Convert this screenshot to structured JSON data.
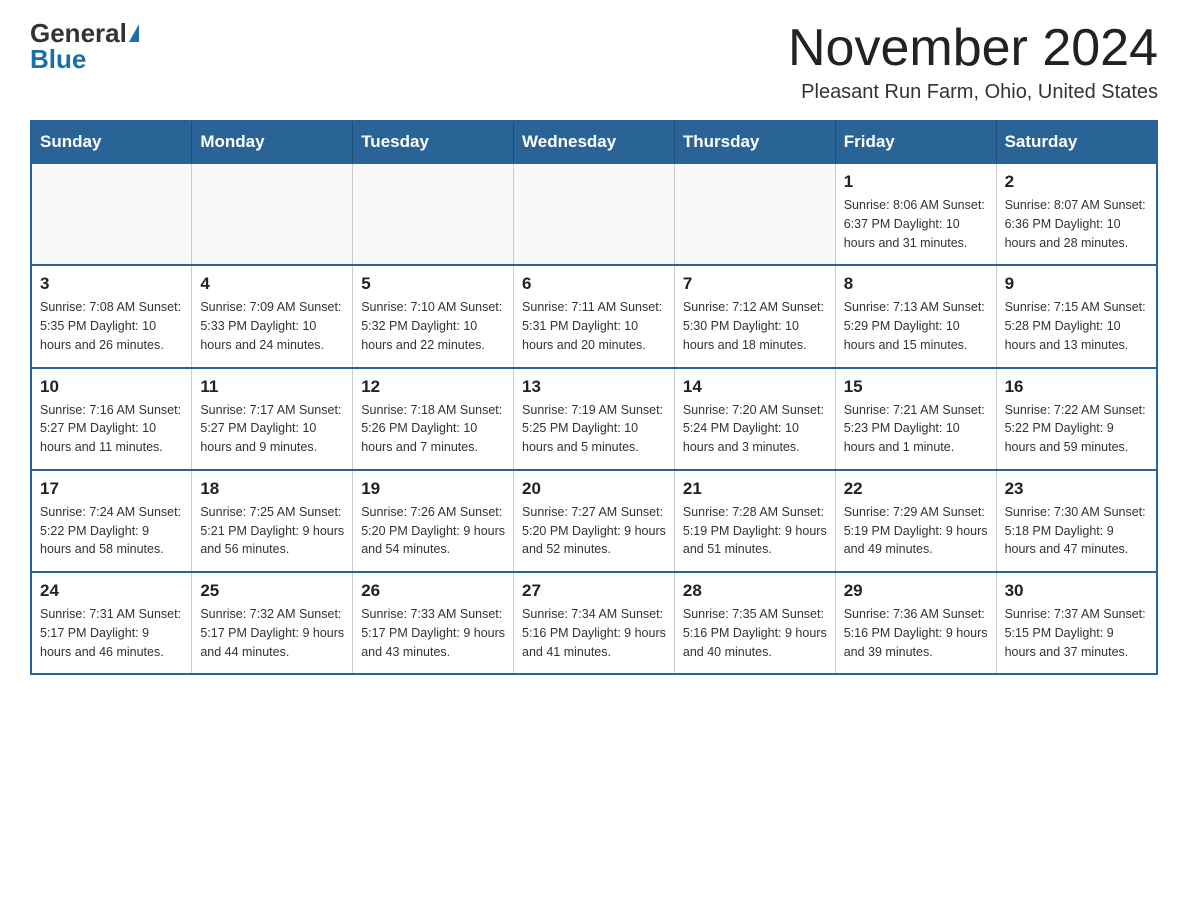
{
  "header": {
    "logo_general": "General",
    "logo_blue": "Blue",
    "month_title": "November 2024",
    "subtitle": "Pleasant Run Farm, Ohio, United States"
  },
  "weekdays": [
    "Sunday",
    "Monday",
    "Tuesday",
    "Wednesday",
    "Thursday",
    "Friday",
    "Saturday"
  ],
  "rows": [
    [
      {
        "day": "",
        "info": ""
      },
      {
        "day": "",
        "info": ""
      },
      {
        "day": "",
        "info": ""
      },
      {
        "day": "",
        "info": ""
      },
      {
        "day": "",
        "info": ""
      },
      {
        "day": "1",
        "info": "Sunrise: 8:06 AM\nSunset: 6:37 PM\nDaylight: 10 hours\nand 31 minutes."
      },
      {
        "day": "2",
        "info": "Sunrise: 8:07 AM\nSunset: 6:36 PM\nDaylight: 10 hours\nand 28 minutes."
      }
    ],
    [
      {
        "day": "3",
        "info": "Sunrise: 7:08 AM\nSunset: 5:35 PM\nDaylight: 10 hours\nand 26 minutes."
      },
      {
        "day": "4",
        "info": "Sunrise: 7:09 AM\nSunset: 5:33 PM\nDaylight: 10 hours\nand 24 minutes."
      },
      {
        "day": "5",
        "info": "Sunrise: 7:10 AM\nSunset: 5:32 PM\nDaylight: 10 hours\nand 22 minutes."
      },
      {
        "day": "6",
        "info": "Sunrise: 7:11 AM\nSunset: 5:31 PM\nDaylight: 10 hours\nand 20 minutes."
      },
      {
        "day": "7",
        "info": "Sunrise: 7:12 AM\nSunset: 5:30 PM\nDaylight: 10 hours\nand 18 minutes."
      },
      {
        "day": "8",
        "info": "Sunrise: 7:13 AM\nSunset: 5:29 PM\nDaylight: 10 hours\nand 15 minutes."
      },
      {
        "day": "9",
        "info": "Sunrise: 7:15 AM\nSunset: 5:28 PM\nDaylight: 10 hours\nand 13 minutes."
      }
    ],
    [
      {
        "day": "10",
        "info": "Sunrise: 7:16 AM\nSunset: 5:27 PM\nDaylight: 10 hours\nand 11 minutes."
      },
      {
        "day": "11",
        "info": "Sunrise: 7:17 AM\nSunset: 5:27 PM\nDaylight: 10 hours\nand 9 minutes."
      },
      {
        "day": "12",
        "info": "Sunrise: 7:18 AM\nSunset: 5:26 PM\nDaylight: 10 hours\nand 7 minutes."
      },
      {
        "day": "13",
        "info": "Sunrise: 7:19 AM\nSunset: 5:25 PM\nDaylight: 10 hours\nand 5 minutes."
      },
      {
        "day": "14",
        "info": "Sunrise: 7:20 AM\nSunset: 5:24 PM\nDaylight: 10 hours\nand 3 minutes."
      },
      {
        "day": "15",
        "info": "Sunrise: 7:21 AM\nSunset: 5:23 PM\nDaylight: 10 hours\nand 1 minute."
      },
      {
        "day": "16",
        "info": "Sunrise: 7:22 AM\nSunset: 5:22 PM\nDaylight: 9 hours\nand 59 minutes."
      }
    ],
    [
      {
        "day": "17",
        "info": "Sunrise: 7:24 AM\nSunset: 5:22 PM\nDaylight: 9 hours\nand 58 minutes."
      },
      {
        "day": "18",
        "info": "Sunrise: 7:25 AM\nSunset: 5:21 PM\nDaylight: 9 hours\nand 56 minutes."
      },
      {
        "day": "19",
        "info": "Sunrise: 7:26 AM\nSunset: 5:20 PM\nDaylight: 9 hours\nand 54 minutes."
      },
      {
        "day": "20",
        "info": "Sunrise: 7:27 AM\nSunset: 5:20 PM\nDaylight: 9 hours\nand 52 minutes."
      },
      {
        "day": "21",
        "info": "Sunrise: 7:28 AM\nSunset: 5:19 PM\nDaylight: 9 hours\nand 51 minutes."
      },
      {
        "day": "22",
        "info": "Sunrise: 7:29 AM\nSunset: 5:19 PM\nDaylight: 9 hours\nand 49 minutes."
      },
      {
        "day": "23",
        "info": "Sunrise: 7:30 AM\nSunset: 5:18 PM\nDaylight: 9 hours\nand 47 minutes."
      }
    ],
    [
      {
        "day": "24",
        "info": "Sunrise: 7:31 AM\nSunset: 5:17 PM\nDaylight: 9 hours\nand 46 minutes."
      },
      {
        "day": "25",
        "info": "Sunrise: 7:32 AM\nSunset: 5:17 PM\nDaylight: 9 hours\nand 44 minutes."
      },
      {
        "day": "26",
        "info": "Sunrise: 7:33 AM\nSunset: 5:17 PM\nDaylight: 9 hours\nand 43 minutes."
      },
      {
        "day": "27",
        "info": "Sunrise: 7:34 AM\nSunset: 5:16 PM\nDaylight: 9 hours\nand 41 minutes."
      },
      {
        "day": "28",
        "info": "Sunrise: 7:35 AM\nSunset: 5:16 PM\nDaylight: 9 hours\nand 40 minutes."
      },
      {
        "day": "29",
        "info": "Sunrise: 7:36 AM\nSunset: 5:16 PM\nDaylight: 9 hours\nand 39 minutes."
      },
      {
        "day": "30",
        "info": "Sunrise: 7:37 AM\nSunset: 5:15 PM\nDaylight: 9 hours\nand 37 minutes."
      }
    ]
  ]
}
